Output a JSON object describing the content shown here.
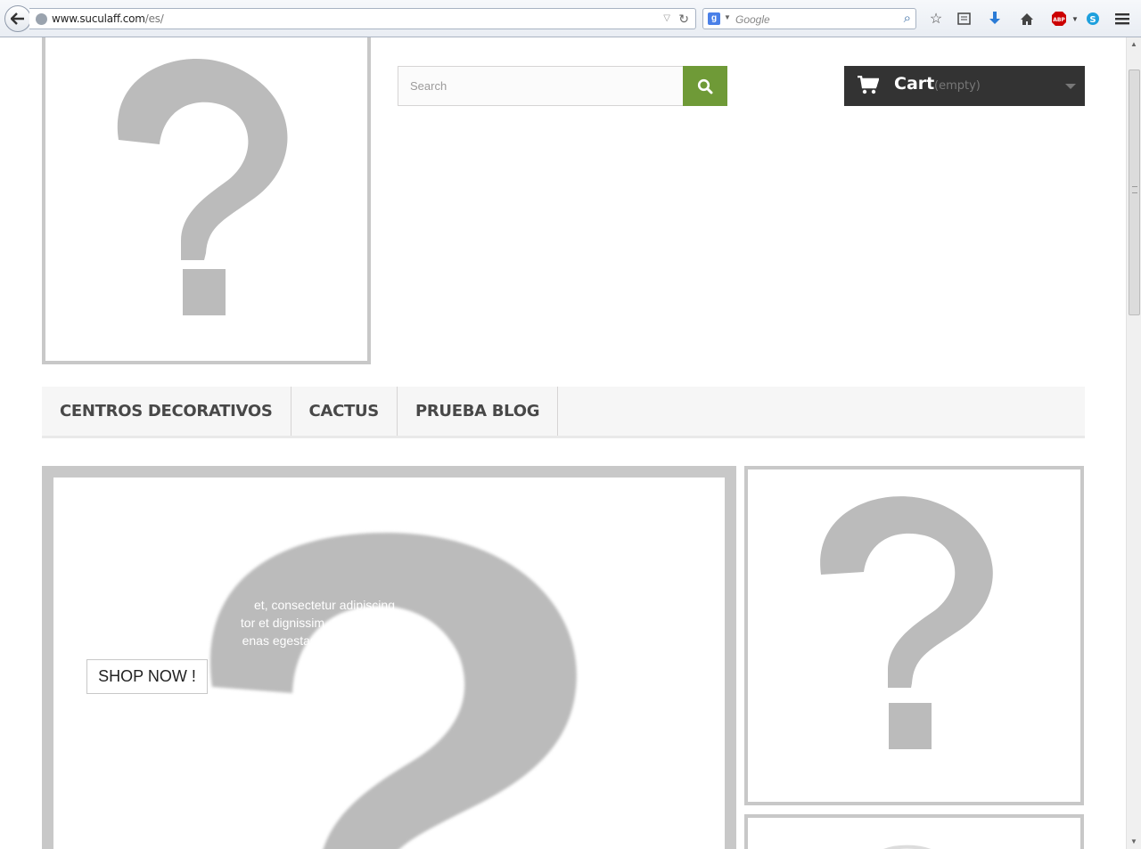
{
  "browser": {
    "url_host": "www.suculaff.com",
    "url_path": "/es/",
    "search_placeholder": "Google",
    "search_engine_icon": "g-icon"
  },
  "header": {
    "search_placeholder": "Search",
    "cart_label": "Cart",
    "cart_status": "(empty)"
  },
  "menu": {
    "items": [
      {
        "label": "CENTROS DECORATIVOS"
      },
      {
        "label": "CACTUS"
      },
      {
        "label": "PRUEBA BLOG"
      }
    ]
  },
  "slider": {
    "caption_lines": [
      "et, consectetur adipiscing",
      "tor et dignissim. Quisque",
      "enas egestas sem elit"
    ],
    "button_label": "SHOP NOW !"
  },
  "colors": {
    "search_button": "#6f9a37",
    "cart_background": "#333333",
    "placeholder_glyph": "#bbbbbb"
  }
}
